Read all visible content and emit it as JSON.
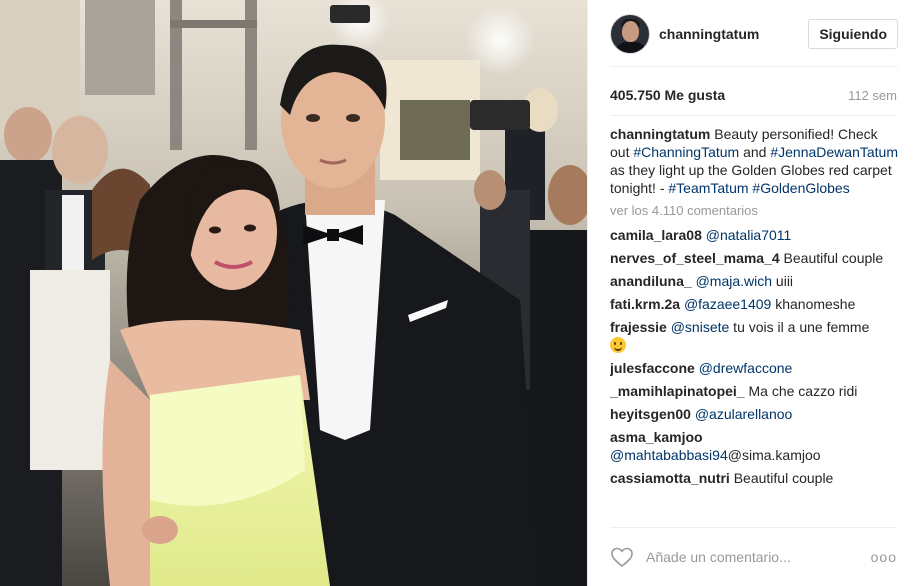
{
  "post": {
    "photo_icon": "photo",
    "photo_subject": "couple-red-carpet"
  },
  "header": {
    "username": "channingtatum",
    "follow_label": "Siguiendo",
    "avatar_icon": "profile-avatar"
  },
  "meta": {
    "likes": "405.750 Me gusta",
    "age": "112 sem"
  },
  "caption": {
    "username": "channingtatum",
    "text_1": " Beauty personified! Check out ",
    "tag_1": "#ChanningTatum",
    "text_2": " and ",
    "tag_2": "#JennaDewanTatum",
    "text_3": " as they light up the Golden Globes red carpet tonight! - ",
    "tag_3": "#TeamTatum",
    "text_4": " ",
    "tag_4": "#GoldenGlobes"
  },
  "view_all": "ver los 4.110 comentarios",
  "comments": [
    {
      "user": "camila_lara08",
      "mention": "@natalia7011",
      "text": ""
    },
    {
      "user": "nerves_of_steel_mama_4",
      "mention": "",
      "text": " Beautiful couple"
    },
    {
      "user": "anandiluna_",
      "mention": "@maja.wich",
      "text": " uiii"
    },
    {
      "user": "fati.krm.2a",
      "mention": "@fazaee1409",
      "text": " khanomeshe"
    },
    {
      "user": "frajessie",
      "mention": "@snisete",
      "text": " tu vois il a une femme"
    },
    {
      "user": "julesfaccone",
      "mention": "@drewfaccone",
      "text": ""
    },
    {
      "user": "_mamihlapinatopei_",
      "mention": "",
      "text": " Ma che cazzo ridi"
    },
    {
      "user": "heyitsgen00",
      "mention": "@azularellanoo",
      "text": ""
    },
    {
      "user": "asma_kamjoo",
      "mention": "@mahtababbasi94",
      "text": "@sima.kamjoo"
    },
    {
      "user": "cassiamotta_nutri",
      "mention": "",
      "text": " Beautiful couple"
    }
  ],
  "footer": {
    "placeholder": "Añade un comentario...",
    "more_label": "ooo",
    "heart_icon": "heart-icon"
  },
  "colors": {
    "link": "#003569",
    "muted": "#999999",
    "border": "#efefef",
    "text": "#262626"
  }
}
